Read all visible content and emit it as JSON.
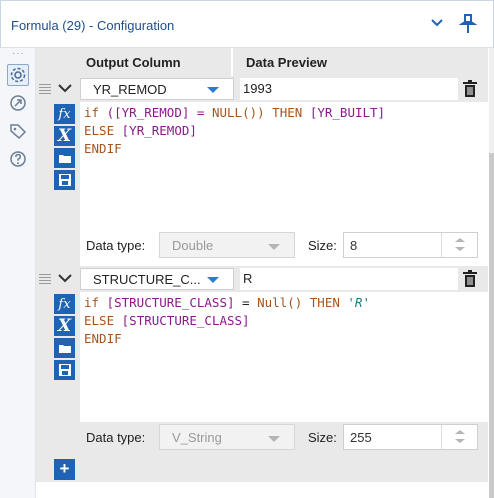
{
  "window": {
    "title": "Formula (29) - Configuration"
  },
  "table": {
    "headers": {
      "output_column": "Output Column",
      "data_preview": "Data Preview"
    }
  },
  "formulas": [
    {
      "output_column": "YR_REMOD",
      "preview": "1993",
      "data_type_label": "Data type:",
      "data_type": "Double",
      "size_label": "Size:",
      "size": "8",
      "expression": {
        "line1": [
          "if ",
          "([",
          "YR_REMOD",
          "] = ",
          "NULL()",
          ") THEN ",
          "[YR_BUILT]"
        ],
        "line2": [
          "ELSE ",
          "[YR_REMOD]"
        ],
        "line3": "ENDIF"
      }
    },
    {
      "output_column": "STRUCTURE_C...",
      "preview": "R",
      "data_type_label": "Data type:",
      "data_type": "V_String",
      "size_label": "Size:",
      "size": "255",
      "expression": {
        "line1": [
          "if ",
          "[STRUCTURE_CLASS]",
          " = ",
          "Null()",
          " THEN ",
          "'R'"
        ],
        "line2": [
          "ELSE ",
          "[STRUCTURE_CLASS]"
        ],
        "line3": "ENDIF"
      }
    }
  ],
  "toolbar": {
    "add_label": "+"
  },
  "icons": {
    "rail": [
      "gear-icon",
      "navigate-icon",
      "tag-icon",
      "help-icon"
    ],
    "accent": "#1f64b4",
    "title_color": "#1f4f8a"
  }
}
